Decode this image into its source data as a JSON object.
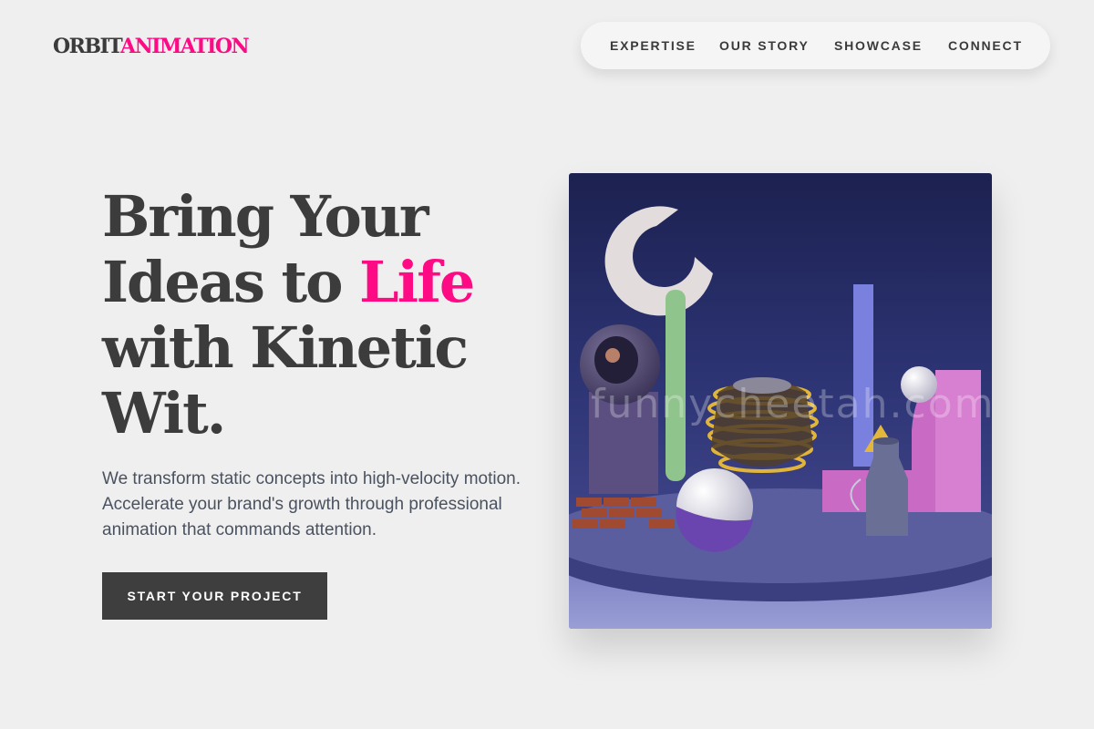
{
  "brand": {
    "part1": "ORBIT",
    "part2": "ANIMATION"
  },
  "nav": {
    "items": [
      {
        "label": "EXPERTISE"
      },
      {
        "label": "OUR STORY"
      },
      {
        "label": "SHOWCASE"
      },
      {
        "label": "CONNECT"
      }
    ]
  },
  "hero": {
    "line1": "Bring Your",
    "line2_prefix": "Ideas to ",
    "line2_highlight": "Life",
    "line3": "with Kinetic",
    "line4": "Wit.",
    "description": "We transform static concepts into high-velocity motion. Accelerate your brand's growth through professional animation that commands attention.",
    "cta_label": "START YOUR PROJECT",
    "watermark": "funnycheetah.com"
  },
  "colors": {
    "accent": "#ff0a85",
    "text": "#3c3c3c",
    "button": "#3e3e3e",
    "background": "#efefef"
  }
}
